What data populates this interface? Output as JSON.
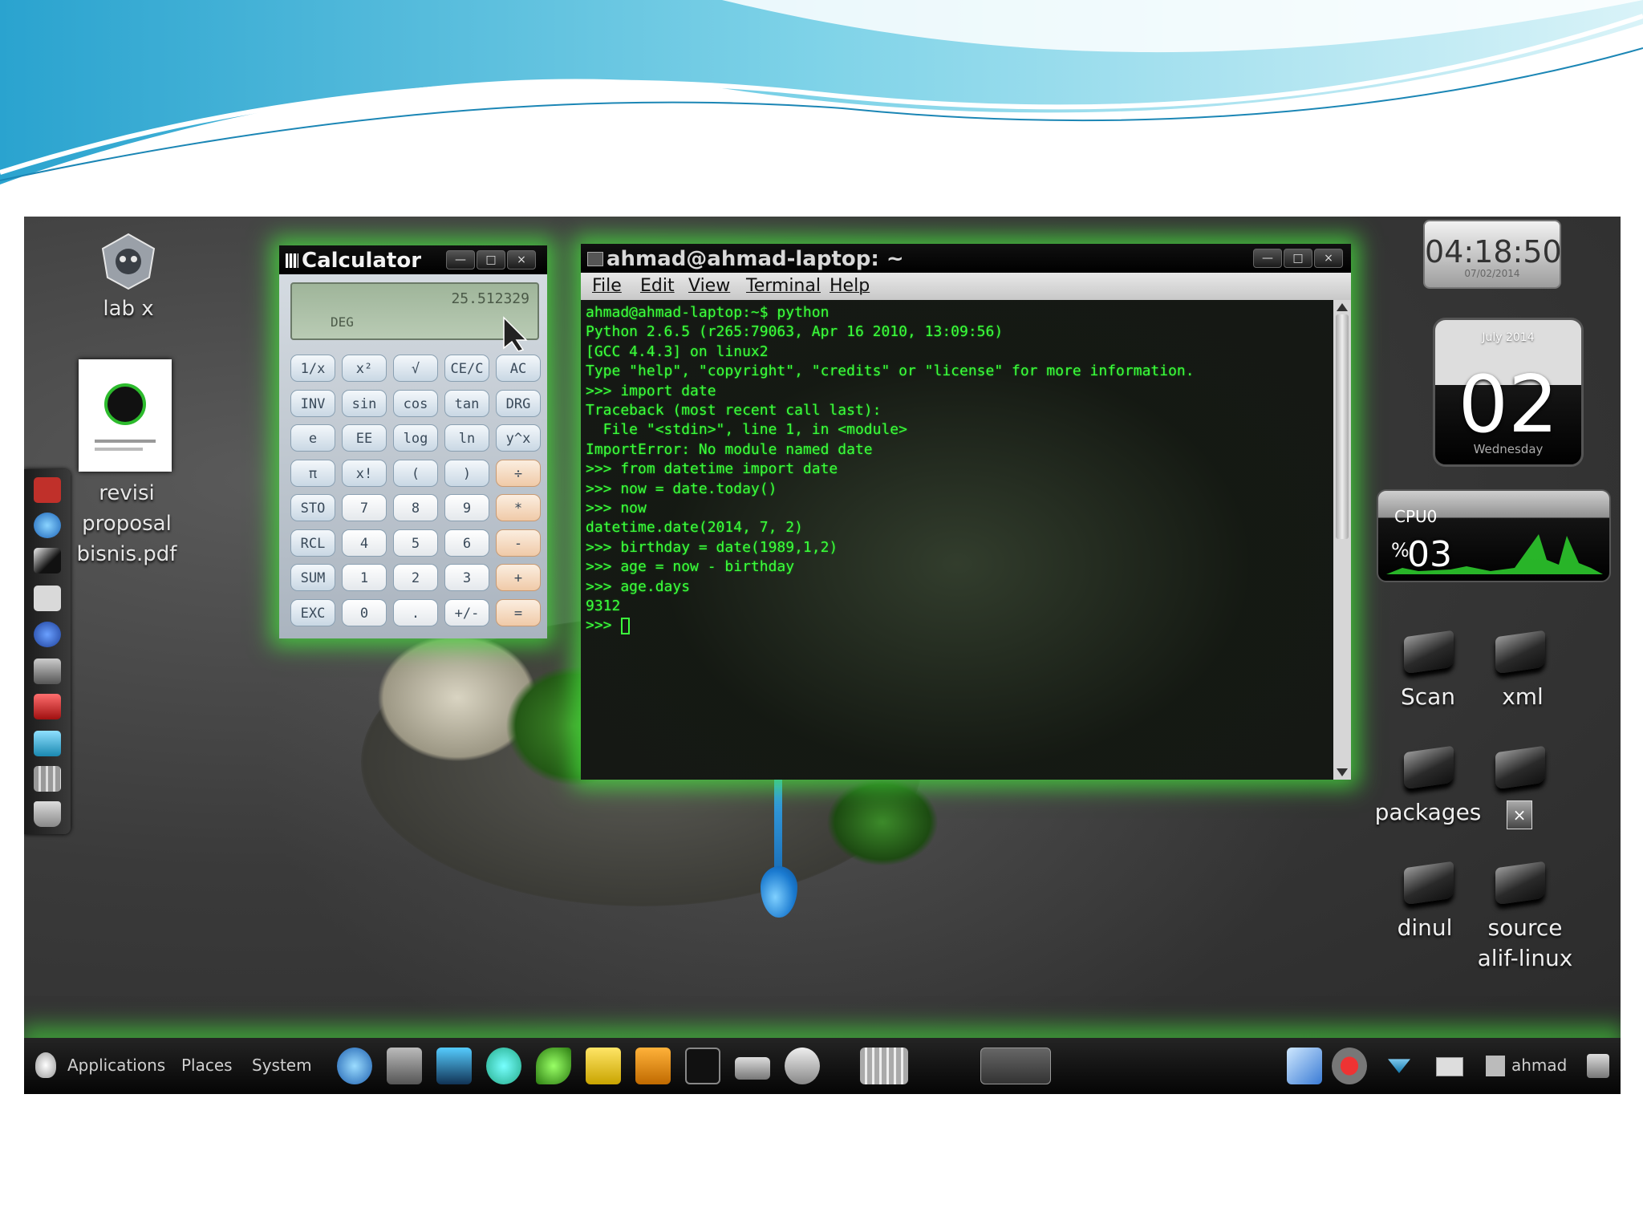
{
  "desktop": {
    "icons": [
      {
        "label": "lab x"
      },
      {
        "label": "revisi proposal bisnis.pdf"
      }
    ]
  },
  "calculator": {
    "title": "Calculator",
    "display_value": "25.512329",
    "display_mode": "DEG",
    "buttons": [
      [
        "1/x",
        "x²",
        "√",
        "CE/C",
        "AC"
      ],
      [
        "INV",
        "sin",
        "cos",
        "tan",
        "DRG"
      ],
      [
        "e",
        "EE",
        "log",
        "ln",
        "y^x"
      ],
      [
        "π",
        "x!",
        "(",
        ")",
        "÷"
      ],
      [
        "STO",
        "7",
        "8",
        "9",
        "*"
      ],
      [
        "RCL",
        "4",
        "5",
        "6",
        "-"
      ],
      [
        "SUM",
        "1",
        "2",
        "3",
        "+"
      ],
      [
        "EXC",
        "0",
        ".",
        "+/-",
        "="
      ]
    ]
  },
  "terminal": {
    "title": "ahmad@ahmad-laptop: ~",
    "menu": [
      "File",
      "Edit",
      "View",
      "Terminal",
      "Help"
    ],
    "lines": [
      "ahmad@ahmad-laptop:~$ python",
      "Python 2.6.5 (r265:79063, Apr 16 2010, 13:09:56)",
      "[GCC 4.4.3] on linux2",
      "Type \"help\", \"copyright\", \"credits\" or \"license\" for more information.",
      ">>> import date",
      "Traceback (most recent call last):",
      "  File \"<stdin>\", line 1, in <module>",
      "ImportError: No module named date",
      ">>> from datetime import date",
      ">>> now = date.today()",
      ">>> now",
      "datetime.date(2014, 7, 2)",
      ">>> birthday = date(1989,1,2)",
      ">>> age = now - birthday",
      ">>> age.days",
      "9312",
      ">>> "
    ]
  },
  "clock": {
    "time": "04:18:50",
    "date": "07/02/2014"
  },
  "calendar": {
    "month": "July 2014",
    "day": "02",
    "weekday": "Wednesday"
  },
  "cpu": {
    "label": "CPU0",
    "percent_symbol": "%",
    "value": "03"
  },
  "folders": [
    {
      "label": "Scan"
    },
    {
      "label": "xml"
    },
    {
      "label": "packages"
    },
    {
      "label": "dinul"
    },
    {
      "label": "source alif-linux"
    }
  ],
  "taskbar": {
    "menus": [
      "Applications",
      "Places",
      "System"
    ],
    "user": "ahmad"
  },
  "colors": {
    "glow": "#46e63c",
    "terminal_text": "#3cff3c",
    "wave_blue": "#3fb3d8"
  }
}
